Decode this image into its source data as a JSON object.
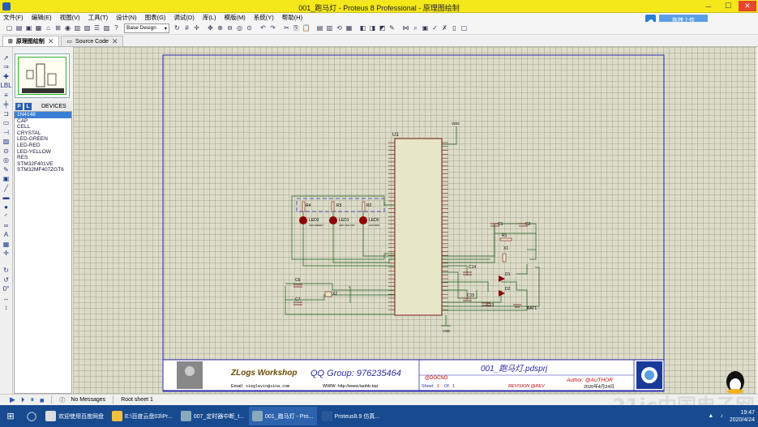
{
  "window": {
    "title": "001_跑马灯 - Proteus 8 Professional - 原理图绘制"
  },
  "menu": [
    "文件(F)",
    "编辑(E)",
    "视图(V)",
    "工具(T)",
    "设计(N)",
    "图表(G)",
    "调试(D)",
    "库(L)",
    "模版(M)",
    "系统(Y)",
    "帮助(H)"
  ],
  "toolbar": {
    "design_select": "Base Design",
    "cloud_label": "拖拽上传"
  },
  "tabs": [
    {
      "label": "原理图绘制"
    },
    {
      "label": "Source Code"
    }
  ],
  "devices": {
    "header": "DEVICES",
    "p_btn": "P",
    "l_btn": "L",
    "items": [
      "1N4148",
      "CAP",
      "CELL",
      "CRYSTAL",
      "LED-GREEN",
      "LED-RED",
      "LED-YELLOW",
      "RES",
      "STM32F401VE",
      "STM32MF407ZGT6"
    ],
    "selected_index": 0
  },
  "schematic": {
    "u1": "U1",
    "vdd": "VDD",
    "vss": "VSS",
    "resistors": [
      {
        "ref": "R4"
      },
      {
        "ref": "R3"
      },
      {
        "ref": "R2"
      },
      {
        "ref": "R1"
      }
    ],
    "leds": [
      {
        "ref": "LED2",
        "type": "LED-GREEN"
      },
      {
        "ref": "LED1",
        "type": "LED-YELLOW"
      },
      {
        "ref": "LED0",
        "type": "LED-RED"
      }
    ],
    "caps": [
      {
        "ref": "C1"
      },
      {
        "ref": "C2"
      },
      {
        "ref": "C6"
      },
      {
        "ref": "C7"
      },
      {
        "ref": "C14"
      },
      {
        "ref": "C15"
      },
      {
        "ref": "C13"
      }
    ],
    "crystals": [
      {
        "ref": "X1"
      },
      {
        "ref": "X2"
      }
    ],
    "diodes": [
      {
        "ref": "D1"
      },
      {
        "ref": "D2"
      }
    ],
    "battery": "BAT1",
    "title_block": {
      "brand": "ZLogs Workshop",
      "qq": "QQ Group: 976235464",
      "email_label": "Email:",
      "email": "sieglevin@sina.com",
      "www": "WWW: http://www.taohb.top",
      "docno": "@DOCNO",
      "sheet": "Sheet",
      "sheet_no": "1",
      "of": "Of",
      "sheet_total": "1",
      "project": "001_跑马灯.pdsprj",
      "revision": "REVISION @REV",
      "author": "Author: @AUTHOR",
      "date": "2020年4月24日"
    }
  },
  "status": {
    "messages": "No Messages",
    "sheet": "Root sheet 1",
    "angle": "0°"
  },
  "taskbar": {
    "items": [
      {
        "label": "欢迎使用百度网盘"
      },
      {
        "label": "E:\\百度云盘03\\Pr..."
      },
      {
        "label": "007_定时器中断_t..."
      },
      {
        "label": "001_跑马灯 - Pro..."
      },
      {
        "label": "Proteus8.9 仿真..."
      }
    ],
    "time": "19:47",
    "date": "2020/4/24"
  },
  "watermark": "21ic中国电子网",
  "colors": {
    "titlebar": "#f4e71a",
    "canvas": "#dcdcc8",
    "border": "#2d2db4",
    "wire": "#1e5f1e",
    "led": "#8b0000",
    "taskbar": "#174a8f"
  }
}
